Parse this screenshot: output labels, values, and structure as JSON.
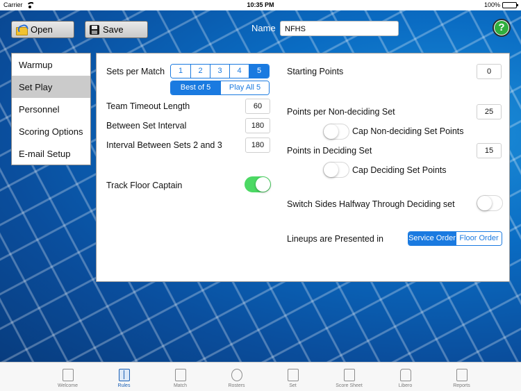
{
  "status_bar": {
    "carrier": "Carrier",
    "time": "10:35 PM",
    "battery": "100%"
  },
  "toolbar": {
    "open_label": "Open",
    "save_label": "Save",
    "name_label": "Name",
    "name_value": "NFHS",
    "help_label": "?"
  },
  "sidebar": {
    "items": [
      {
        "label": "Warmup"
      },
      {
        "label": "Set Play"
      },
      {
        "label": "Personnel"
      },
      {
        "label": "Scoring Options"
      },
      {
        "label": "E-mail Setup"
      }
    ]
  },
  "panel": {
    "sets_per_match_label": "Sets per Match",
    "sets_options": [
      "1",
      "2",
      "3",
      "4",
      "5"
    ],
    "sets_selected": "5",
    "match_format_options": [
      "Best of 5",
      "Play All 5"
    ],
    "match_format_selected": "Best of 5",
    "team_timeout_label": "Team Timeout Length",
    "team_timeout_value": "60",
    "between_set_label": "Between Set Interval",
    "between_set_value": "180",
    "interval_2_3_label": "Interval Between Sets 2 and 3",
    "interval_2_3_value": "180",
    "track_floor_captain_label": "Track Floor Captain",
    "track_floor_captain_on": true,
    "starting_points_label": "Starting Points",
    "starting_points_value": "0",
    "points_non_deciding_label": "Points per Non-deciding Set",
    "points_non_deciding_value": "25",
    "cap_non_deciding_label": "Cap Non-deciding Set Points",
    "cap_non_deciding_on": false,
    "points_deciding_label": "Points in Deciding Set",
    "points_deciding_value": "15",
    "cap_deciding_label": "Cap Deciding Set Points",
    "cap_deciding_on": false,
    "switch_sides_label": "Switch Sides Halfway Through Deciding set",
    "switch_sides_on": false,
    "lineups_label": "Lineups are Presented in",
    "lineup_options": [
      "Service Order",
      "Floor Order"
    ],
    "lineup_selected": "Service Order"
  },
  "tab_bar": {
    "tabs": [
      {
        "label": "Welcome",
        "icon": "door-icon"
      },
      {
        "label": "Rules",
        "icon": "book-icon"
      },
      {
        "label": "Match",
        "icon": "volleyball-icon"
      },
      {
        "label": "Rosters",
        "icon": "people-icon"
      },
      {
        "label": "Set",
        "icon": "net-icon"
      },
      {
        "label": "Score Sheet",
        "icon": "scoresheet-icon"
      },
      {
        "label": "Libero",
        "icon": "jersey-icon"
      },
      {
        "label": "Reports",
        "icon": "report-icon"
      }
    ],
    "active": "Rules"
  },
  "colors": {
    "accent": "#1a7ae0",
    "toggle_on": "#4cd964",
    "help": "#2fae3d"
  }
}
